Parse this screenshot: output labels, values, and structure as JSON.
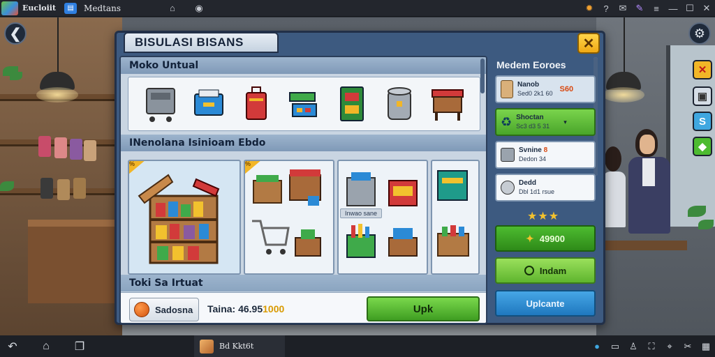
{
  "topbar": {
    "app_name": "Eucloiit",
    "tab_label": "Medtans",
    "left_buttons": [
      "home-icon",
      "camera-icon"
    ],
    "right_buttons": [
      "sun-icon",
      "help-icon",
      "message-icon",
      "pen-icon",
      "menu-icon",
      "minimize-icon",
      "maximize-icon",
      "close-icon"
    ]
  },
  "dialog": {
    "title": "BISULASI BISANS",
    "close_glyph": "✕",
    "sections": {
      "top": "Moko Untual",
      "middle": "INenolana Isinioam Ebdo",
      "bottom": "Toki Sa Irtuat"
    },
    "card_badge": "Inwao sane",
    "secondary_button": "Sadosna",
    "total_label": "Taina: ",
    "total_prefix": "46.95",
    "total_highlight": "1000",
    "primary_button": "Upk"
  },
  "side_panel": {
    "heading": "Medem Eoroes",
    "cards": [
      {
        "name": "Nanob",
        "sub": "Sed0 2k1 60",
        "price": "S60",
        "style": "default"
      },
      {
        "name": "Shoctan",
        "sub": "Sc3 d3 5 31",
        "price": "",
        "style": "green"
      },
      {
        "name": "Svnine",
        "sub": "Dedon 34",
        "price": "8",
        "style": "white"
      },
      {
        "name": "Dedd",
        "sub": "Dbl 1d1 rsue",
        "price": "",
        "style": "default"
      }
    ],
    "stars": "★★★",
    "money_button": "49900",
    "lime_button": "Indam",
    "blue_button": "Uplcante"
  },
  "navbar": {
    "app_label": "Bd Kkt6t",
    "left_buttons": [
      "back-icon",
      "home-icon",
      "recent-apps-icon"
    ],
    "right_buttons": [
      "info-icon",
      "screen-icon",
      "person-icon",
      "fullscreen-icon",
      "location-icon",
      "scissors-icon",
      "multi-instance-icon"
    ]
  },
  "colors": {
    "accent_green": "#49a52a",
    "accent_blue": "#1f78bf",
    "dialog_frame": "#3d5a80",
    "close_yellow": "#f0a915",
    "price_orange": "#d9480f"
  }
}
